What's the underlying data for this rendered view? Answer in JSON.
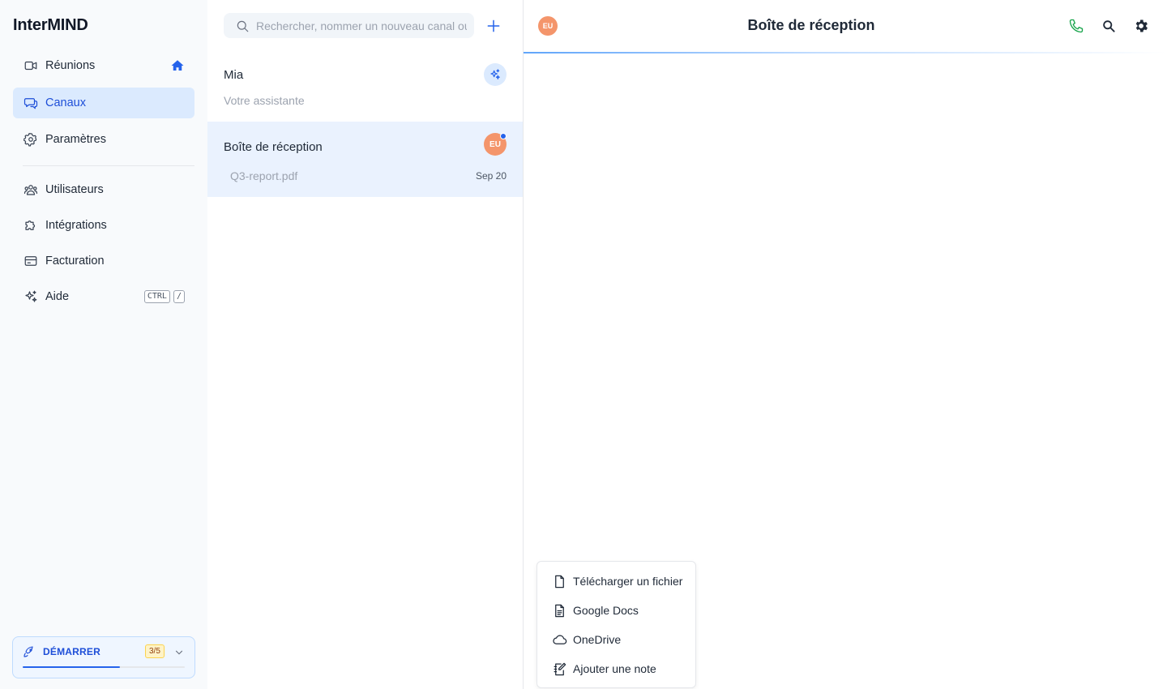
{
  "app": {
    "brand": "InterMIND"
  },
  "sidebar": {
    "items": [
      {
        "label": "Réunions",
        "icon": "video-camera-icon"
      },
      {
        "label": "Canaux",
        "icon": "chat-bubbles-icon",
        "active": true
      },
      {
        "label": "Paramètres",
        "icon": "gear-icon"
      },
      {
        "label": "Utilisateurs",
        "icon": "users-icon"
      },
      {
        "label": "Intégrations",
        "icon": "puzzle-icon"
      },
      {
        "label": "Facturation",
        "icon": "credit-card-icon"
      },
      {
        "label": "Aide",
        "icon": "sparkles-icon"
      }
    ],
    "shortcut": {
      "key1": "CTRL",
      "key2": "/"
    },
    "onboarding": {
      "label": "DÉMARRER",
      "count": "3/5",
      "progress": 0.6
    }
  },
  "channel_list": {
    "search_placeholder": "Rechercher, nommer un nouveau canal ou",
    "channels": [
      {
        "title": "Mia",
        "subtitle": "Votre assistante",
        "badge_icon": "sparkles-icon"
      },
      {
        "title": "Boîte de réception",
        "subtitle": "Q3-report.pdf",
        "date": "Sep 20",
        "avatar": "EU",
        "unread": true,
        "selected": true
      }
    ]
  },
  "main": {
    "title": "Boîte de réception",
    "avatar": "EU",
    "actions": [
      "phone-icon",
      "search-icon",
      "gear-icon"
    ]
  },
  "attach_menu": {
    "items": [
      {
        "label": "Télécharger un fichier",
        "icon": "file-icon"
      },
      {
        "label": "Google Docs",
        "icon": "document-lines-icon"
      },
      {
        "label": "OneDrive",
        "icon": "cloud-icon"
      },
      {
        "label": "Ajouter une note",
        "icon": "note-edit-icon"
      }
    ]
  },
  "colors": {
    "accent": "#2563eb",
    "avatar": "#f4956b",
    "selected_bg": "#eaf2fe",
    "phone": "#16a34a"
  }
}
